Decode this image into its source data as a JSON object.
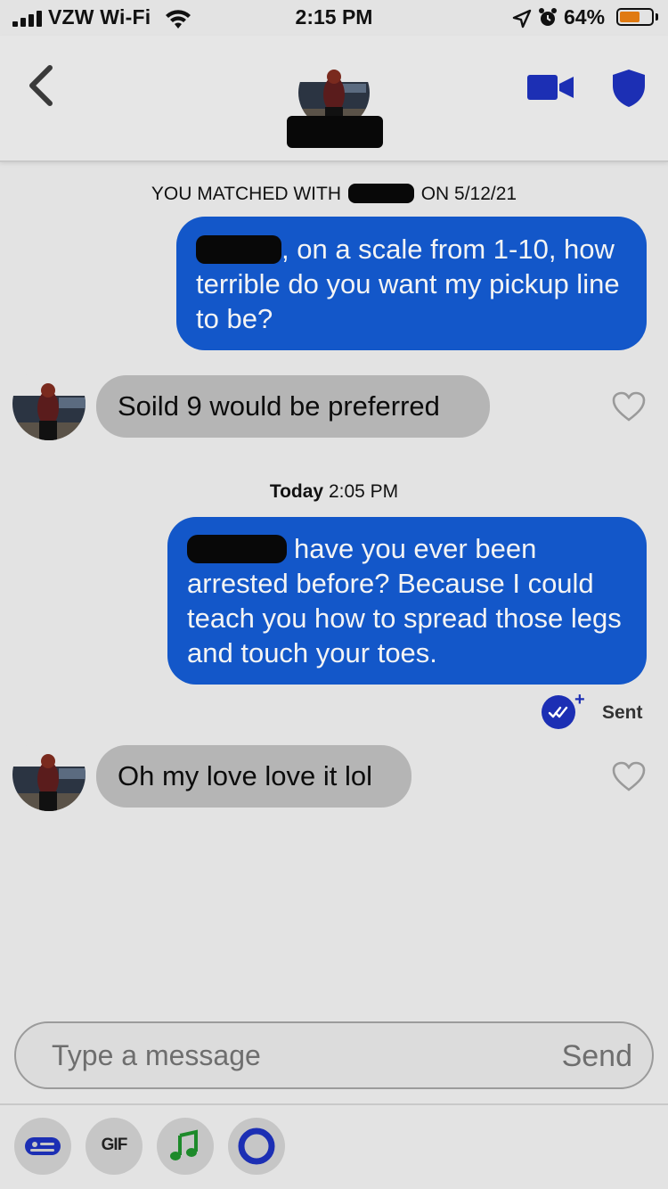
{
  "status_bar": {
    "carrier": "VZW Wi-Fi",
    "time": "2:15 PM",
    "battery_pct": "64%",
    "battery_level": 0.64,
    "battery_color": "#e07a12"
  },
  "header": {
    "back_icon": "chevron-left-icon",
    "video_icon": "video-camera-icon",
    "safety_icon": "shield-icon",
    "accent": "#1c2fb4"
  },
  "chat": {
    "match_prefix": "YOU MATCHED WITH",
    "match_suffix": "ON 5/12/21",
    "msg1_out": ", on a scale from 1-10, how terrible do you want my pickup line to be?",
    "msg1_in": "Soild 9 would be preferred",
    "today_label": "Today",
    "today_time": "2:05 PM",
    "msg2_out": "have you ever been arrested before? Because I could teach you how to spread those legs and touch your toes.",
    "sent_label": "Sent",
    "msg2_in": "Oh my love love it lol",
    "outgoing_color": "#1357c9",
    "incoming_color": "#b5b5b5"
  },
  "composer": {
    "placeholder": "Type a message",
    "send_label": "Send"
  },
  "toolbar": {
    "gif_label": "GIF",
    "items": [
      "sticker-icon",
      "gif-icon",
      "music-note-icon",
      "ring-icon"
    ]
  }
}
